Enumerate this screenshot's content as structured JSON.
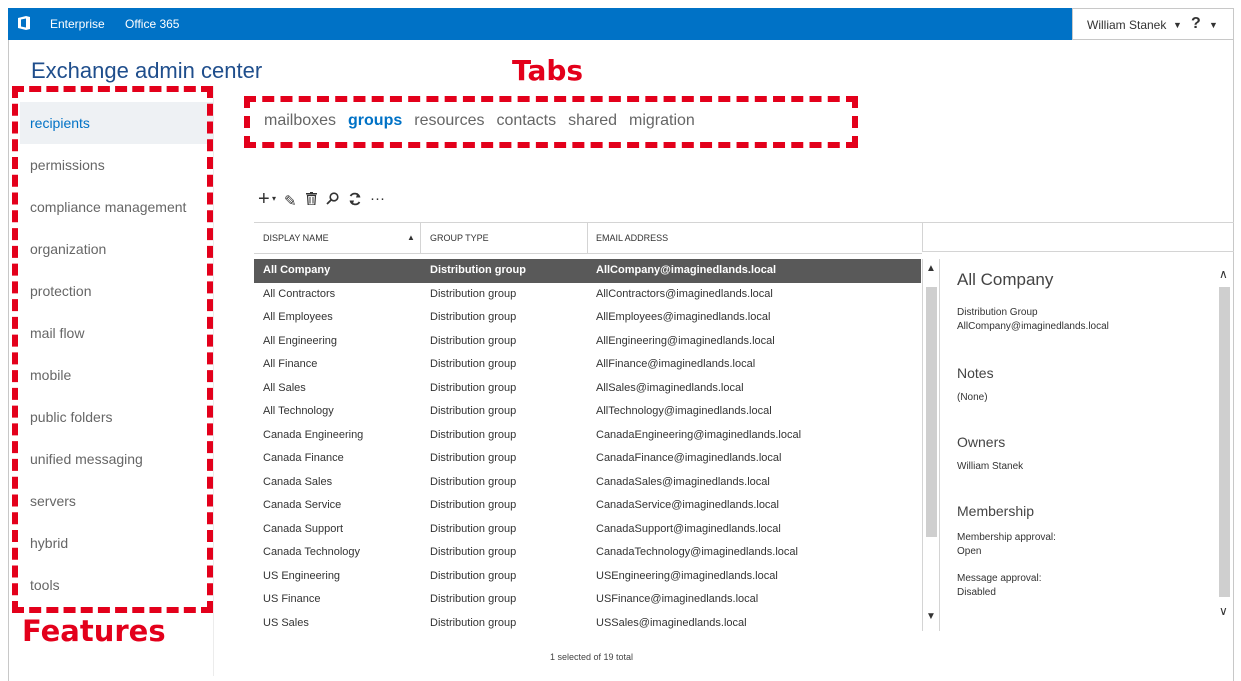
{
  "header": {
    "enterprise": "Enterprise",
    "office": "Office 365",
    "user": "William Stanek",
    "help": "?"
  },
  "app_title": "Exchange admin center",
  "annotations": {
    "tabs": "Tabs",
    "features": "Features"
  },
  "sidebar": {
    "items": [
      {
        "label": "recipients",
        "active": true
      },
      {
        "label": "permissions"
      },
      {
        "label": "compliance management"
      },
      {
        "label": "organization"
      },
      {
        "label": "protection"
      },
      {
        "label": "mail flow"
      },
      {
        "label": "mobile"
      },
      {
        "label": "public folders"
      },
      {
        "label": "unified messaging"
      },
      {
        "label": "servers"
      },
      {
        "label": "hybrid"
      },
      {
        "label": "tools"
      }
    ]
  },
  "tabs": [
    "mailboxes",
    "groups",
    "resources",
    "contacts",
    "shared",
    "migration"
  ],
  "selected_tab": "groups",
  "toolbar": {
    "icons": [
      "add-icon",
      "edit-icon",
      "delete-icon",
      "search-icon",
      "refresh-icon",
      "more-icon"
    ]
  },
  "table": {
    "headers": [
      "DISPLAY NAME",
      "GROUP TYPE",
      "EMAIL ADDRESS"
    ],
    "rows": [
      [
        "All Company",
        "Distribution group",
        "AllCompany@imaginedlands.local"
      ],
      [
        "All Contractors",
        "Distribution group",
        "AllContractors@imaginedlands.local"
      ],
      [
        "All Employees",
        "Distribution group",
        "AllEmployees@imaginedlands.local"
      ],
      [
        "All Engineering",
        "Distribution group",
        "AllEngineering@imaginedlands.local"
      ],
      [
        "All Finance",
        "Distribution group",
        "AllFinance@imaginedlands.local"
      ],
      [
        "All Sales",
        "Distribution group",
        "AllSales@imaginedlands.local"
      ],
      [
        "All Technology",
        "Distribution group",
        "AllTechnology@imaginedlands.local"
      ],
      [
        "Canada Engineering",
        "Distribution group",
        "CanadaEngineering@imaginedlands.local"
      ],
      [
        "Canada Finance",
        "Distribution group",
        "CanadaFinance@imaginedlands.local"
      ],
      [
        "Canada Sales",
        "Distribution group",
        "CanadaSales@imaginedlands.local"
      ],
      [
        "Canada Service",
        "Distribution group",
        "CanadaService@imaginedlands.local"
      ],
      [
        "Canada Support",
        "Distribution group",
        "CanadaSupport@imaginedlands.local"
      ],
      [
        "Canada Technology",
        "Distribution group",
        "CanadaTechnology@imaginedlands.local"
      ],
      [
        "US Engineering",
        "Distribution group",
        "USEngineering@imaginedlands.local"
      ],
      [
        "US Finance",
        "Distribution group",
        "USFinance@imaginedlands.local"
      ],
      [
        "US Sales",
        "Distribution group",
        "USSales@imaginedlands.local"
      ]
    ],
    "selected_row": 0,
    "footer": "1 selected of 19 total"
  },
  "details": {
    "title": "All Company",
    "type": "Distribution Group",
    "email": "AllCompany@imaginedlands.local",
    "notes_heading": "Notes",
    "notes": "(None)",
    "owners_heading": "Owners",
    "owner": "William Stanek",
    "membership_heading": "Membership",
    "membership_approval_label": "Membership approval:",
    "membership_approval_value": "Open",
    "message_approval_label": "Message approval:",
    "message_approval_value": "Disabled"
  },
  "colors": {
    "topbar": "#0072c6",
    "accent": "#0072c6",
    "annotation": "#e3001b",
    "selected_row": "#595959"
  }
}
